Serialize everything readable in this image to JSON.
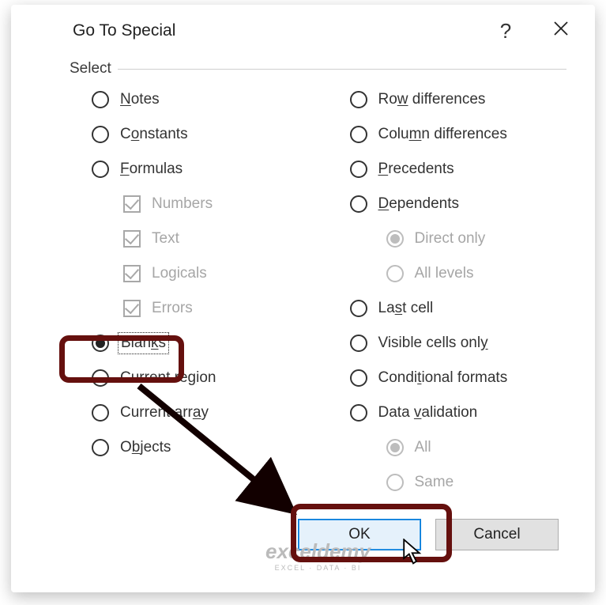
{
  "titlebar": {
    "title": "Go To Special",
    "help": "?",
    "close": "close"
  },
  "group_label": "Select",
  "left": {
    "notes": "Notes",
    "constants": "Constants",
    "formulas": "Formulas",
    "numbers": "Numbers",
    "text": "Text",
    "logicals": "Logicals",
    "errors": "Errors",
    "blanks": "Blanks",
    "current_region": "Current region",
    "current_array": "Current array",
    "objects": "Objects"
  },
  "right": {
    "row_diff": "Row differences",
    "col_diff": "Column differences",
    "precedents": "Precedents",
    "dependents": "Dependents",
    "direct_only": "Direct only",
    "all_levels": "All levels",
    "last_cell": "Last cell",
    "visible_cells": "Visible cells only",
    "cond_formats": "Conditional formats",
    "data_validation": "Data validation",
    "all": "All",
    "same": "Same"
  },
  "buttons": {
    "ok": "OK",
    "cancel": "Cancel"
  },
  "watermark": {
    "brand": "exceldemy",
    "tagline": "EXCEL · DATA · BI"
  },
  "underlines": {
    "notes_u": "N",
    "notes_rest": "otes",
    "constants_pre": "C",
    "constants_u": "o",
    "constants_rest": "nstants",
    "formulas_u": "F",
    "formulas_rest": "ormulas",
    "blanks_pre": "Blan",
    "blanks_u": "k",
    "blanks_rest": "s",
    "cr_pre": "Current re",
    "cr_u": "g",
    "cr_rest": "ion",
    "ca_pre": "Current arr",
    "ca_u": "a",
    "ca_rest": "y",
    "obj_pre": "O",
    "obj_u": "b",
    "obj_rest": "jects",
    "rd_pre": "Ro",
    "rd_u": "w",
    "rd_rest": " differences",
    "cd_pre": "Colu",
    "cd_u": "m",
    "cd_rest": "n differences",
    "prec_u": "P",
    "prec_rest": "recedents",
    "dep_u": "D",
    "dep_rest": "ependents",
    "lc_pre": "La",
    "lc_u": "s",
    "lc_rest": "t cell",
    "vc_pre": "Visible cells onl",
    "vc_u": "y",
    "vc_rest": "",
    "cf_pre": "Condi",
    "cf_u": "t",
    "cf_rest": "ional formats",
    "dv_pre": "Data ",
    "dv_u": "v",
    "dv_rest": "alidation"
  }
}
